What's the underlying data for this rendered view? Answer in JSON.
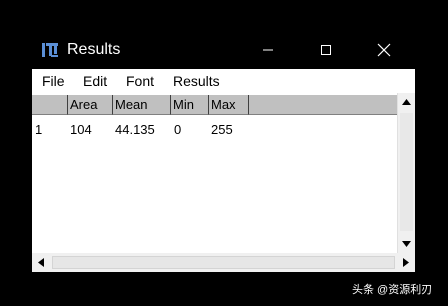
{
  "window": {
    "title": "Results"
  },
  "menu": {
    "items": [
      "File",
      "Edit",
      "Font",
      "Results"
    ]
  },
  "table": {
    "columns": [
      "",
      "Area",
      "Mean",
      "Min",
      "Max"
    ],
    "rows": [
      {
        "index": "1",
        "area": "104",
        "mean": "44.135",
        "min": "0",
        "max": "255"
      }
    ]
  },
  "icons": {
    "app": "imagej-icon",
    "minimize": "minimize-icon",
    "maximize": "maximize-icon",
    "close": "close-icon",
    "scroll_up": "arrow-up-icon",
    "scroll_down": "arrow-down-icon",
    "scroll_left": "arrow-left-icon",
    "scroll_right": "arrow-right-icon"
  },
  "watermark": "头条 @资源利刃"
}
